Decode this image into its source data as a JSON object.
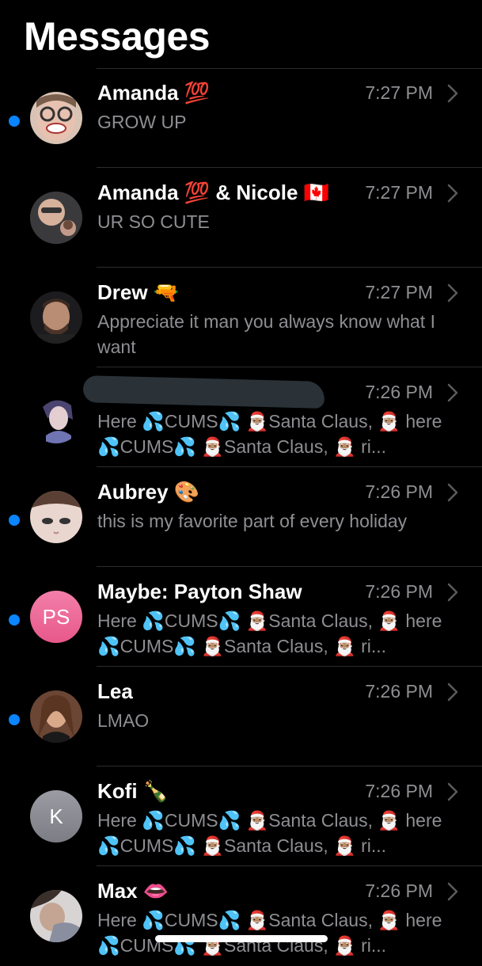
{
  "title": "Messages",
  "conversations": [
    {
      "name": "Amanda 💯",
      "time": "7:27 PM",
      "preview": "GROW UP",
      "unread": true,
      "avatar": "photo"
    },
    {
      "name": "Amanda 💯 & Nicole 🇨🇦",
      "time": "7:27 PM",
      "preview": "UR SO CUTE",
      "unread": false,
      "avatar": "group-photo"
    },
    {
      "name": "Drew 🔫",
      "time": "7:27 PM",
      "preview": "Appreciate it man you always know what I want",
      "unread": false,
      "avatar": "photo"
    },
    {
      "name": "",
      "time": "7:26 PM",
      "preview": "Here 💦CUMS💦 🎅🏽Santa Claus, 🎅🏽 here 💦CUMS💦 🎅🏽Santa Claus, 🎅🏽 ri...",
      "unread": false,
      "avatar": "illustration",
      "redacted": true
    },
    {
      "name": "Aubrey 🎨",
      "time": "7:26 PM",
      "preview": "this is my favorite part of every holiday",
      "unread": true,
      "avatar": "photo"
    },
    {
      "name": "Maybe: Payton Shaw",
      "time": "7:26 PM",
      "preview": "Here 💦CUMS💦 🎅🏽Santa Claus, 🎅🏽 here 💦CUMS💦 🎅🏽Santa Claus, 🎅🏽 ri...",
      "unread": true,
      "avatar": "initials",
      "initials": "PS"
    },
    {
      "name": "Lea",
      "time": "7:26 PM",
      "preview": "LMAO",
      "unread": true,
      "avatar": "photo"
    },
    {
      "name": "Kofi 🍾",
      "time": "7:26 PM",
      "preview": "Here 💦CUMS💦 🎅🏽Santa Claus, 🎅🏽 here 💦CUMS💦 🎅🏽Santa Claus, 🎅🏽 ri...",
      "unread": false,
      "avatar": "initials",
      "initials": "K"
    },
    {
      "name": "Max 👄",
      "time": "7:26 PM",
      "preview": "Here 💦CUMS💦 🎅🏽Santa Claus, 🎅🏽 here 💦CUMS💦 🎅🏽Santa Claus, 🎅🏽 ri...",
      "unread": false,
      "avatar": "photo"
    }
  ],
  "colors": {
    "unread_dot": "#0a84ff",
    "secondary_text": "#8e8e93",
    "background": "#000000"
  }
}
